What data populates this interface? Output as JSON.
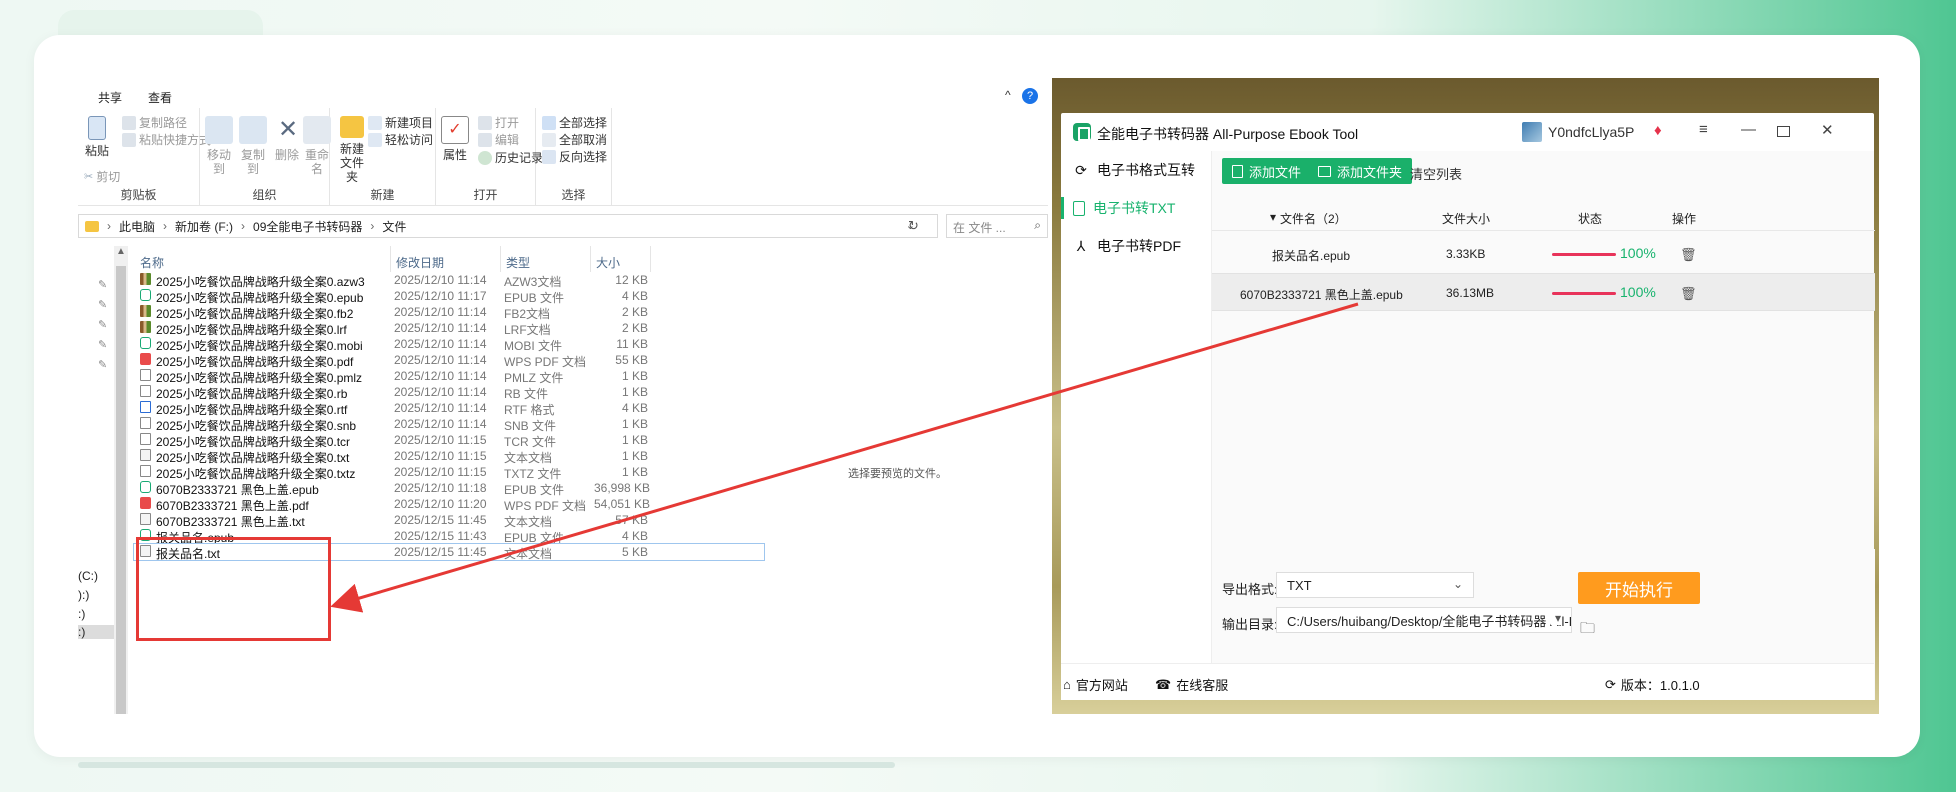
{
  "explorer": {
    "ribbon_tabs": [
      "共享",
      "查看"
    ],
    "ribbon_ctrl_chevron": "^",
    "ribbon_ctrl_help": "?",
    "clipboard": {
      "paste": "粘贴",
      "copy_path": "复制路径",
      "paste_shortcut": "粘贴快捷方式",
      "cut": "剪切",
      "group": "剪贴板"
    },
    "organize": {
      "move_to": "移动到",
      "copy_to": "复制到",
      "delete": "删除",
      "rename": "重命名",
      "group": "组织"
    },
    "new": {
      "new_folder_line1": "新建",
      "new_folder_line2": "文件夹",
      "new_item": "新建项目",
      "easy_access": "轻松访问",
      "group": "新建"
    },
    "open": {
      "properties": "属性",
      "open": "打开",
      "edit": "编辑",
      "history": "历史记录",
      "group": "打开"
    },
    "select": {
      "select_all": "全部选择",
      "select_none": "全部取消",
      "invert": "反向选择",
      "group": "选择"
    },
    "breadcrumb": [
      "此电脑",
      "新加卷 (F:)",
      "09全能电子书转码器",
      "文件"
    ],
    "search_placeholder": "在 文件 ...",
    "nav_drives": [
      "(C:)",
      "):)",
      ":)",
      ":)"
    ],
    "columns": {
      "name": "名称",
      "date": "修改日期",
      "type": "类型",
      "size": "大小"
    },
    "files": [
      {
        "name": "2025小吃餐饮品牌战略升级全案0.azw3",
        "date": "2025/12/10 11:14",
        "type": "AZW3文档",
        "size": "12 KB",
        "icon": "azw-icon"
      },
      {
        "name": "2025小吃餐饮品牌战略升级全案0.epub",
        "date": "2025/12/10 11:17",
        "type": "EPUB 文件",
        "size": "4 KB",
        "icon": "epub-icon"
      },
      {
        "name": "2025小吃餐饮品牌战略升级全案0.fb2",
        "date": "2025/12/10 11:14",
        "type": "FB2文档",
        "size": "2 KB",
        "icon": "azw-icon"
      },
      {
        "name": "2025小吃餐饮品牌战略升级全案0.lrf",
        "date": "2025/12/10 11:14",
        "type": "LRF文档",
        "size": "2 KB",
        "icon": "azw-icon"
      },
      {
        "name": "2025小吃餐饮品牌战略升级全案0.mobi",
        "date": "2025/12/10 11:14",
        "type": "MOBI 文件",
        "size": "11 KB",
        "icon": "epub-icon"
      },
      {
        "name": "2025小吃餐饮品牌战略升级全案0.pdf",
        "date": "2025/12/10 11:14",
        "type": "WPS PDF 文档",
        "size": "55 KB",
        "icon": "pdf-icon"
      },
      {
        "name": "2025小吃餐饮品牌战略升级全案0.pmlz",
        "date": "2025/12/10 11:14",
        "type": "PMLZ 文件",
        "size": "1 KB",
        "icon": "doc-icon"
      },
      {
        "name": "2025小吃餐饮品牌战略升级全案0.rb",
        "date": "2025/12/10 11:14",
        "type": "RB 文件",
        "size": "1 KB",
        "icon": "doc-icon"
      },
      {
        "name": "2025小吃餐饮品牌战略升级全案0.rtf",
        "date": "2025/12/10 11:14",
        "type": "RTF 格式",
        "size": "4 KB",
        "icon": "rtf-icon"
      },
      {
        "name": "2025小吃餐饮品牌战略升级全案0.snb",
        "date": "2025/12/10 11:14",
        "type": "SNB 文件",
        "size": "1 KB",
        "icon": "doc-icon"
      },
      {
        "name": "2025小吃餐饮品牌战略升级全案0.tcr",
        "date": "2025/12/10 11:15",
        "type": "TCR 文件",
        "size": "1 KB",
        "icon": "doc-icon"
      },
      {
        "name": "2025小吃餐饮品牌战略升级全案0.txt",
        "date": "2025/12/10 11:15",
        "type": "文本文档",
        "size": "1 KB",
        "icon": "txt-icon"
      },
      {
        "name": "2025小吃餐饮品牌战略升级全案0.txtz",
        "date": "2025/12/10 11:15",
        "type": "TXTZ 文件",
        "size": "1 KB",
        "icon": "doc-icon"
      },
      {
        "name": "6070B2333721 黑色上盖.epub",
        "date": "2025/12/10 11:18",
        "type": "EPUB 文件",
        "size": "36,998 KB",
        "icon": "epub-icon"
      },
      {
        "name": "6070B2333721 黑色上盖.pdf",
        "date": "2025/12/10 11:20",
        "type": "WPS PDF 文档",
        "size": "54,051 KB",
        "icon": "pdf-icon"
      },
      {
        "name": "6070B2333721 黑色上盖.txt",
        "date": "2025/12/15 11:45",
        "type": "文本文档",
        "size": "57 KB",
        "icon": "txt-icon"
      },
      {
        "name": "报关品名.epub",
        "date": "2025/12/15 11:43",
        "type": "EPUB 文件",
        "size": "4 KB",
        "icon": "epub-icon"
      },
      {
        "name": "报关品名.txt",
        "date": "2025/12/15 11:45",
        "type": "文本文档",
        "size": "5 KB",
        "icon": "txt-icon"
      }
    ],
    "preview_message": "选择要预览的文件。"
  },
  "app": {
    "title": "全能电子书转码器 All-Purpose Ebook Tool",
    "username": "Y0ndfcLlya5P",
    "sidebar": [
      {
        "label": "电子书格式互转",
        "icon": "refresh-icon",
        "active": false
      },
      {
        "label": "电子书转TXT",
        "icon": "txt-doc-icon",
        "active": true
      },
      {
        "label": "电子书转PDF",
        "icon": "pdf-icon",
        "active": false
      }
    ],
    "toolbar": {
      "add_file": "添加文件",
      "add_folder": "添加文件夹",
      "clear_list": "清空列表"
    },
    "table": {
      "col_name": "文件名（2）",
      "col_size": "文件大小",
      "col_status": "状态",
      "col_action": "操作",
      "rows": [
        {
          "name": "报关品名.epub",
          "size": "3.33KB",
          "progress": 1.0,
          "progress_label": "100%"
        },
        {
          "name": "6070B2333721 黑色上盖.epub",
          "size": "36.13MB",
          "progress": 1.0,
          "progress_label": "100%"
        }
      ]
    },
    "output_format_label": "导出格式:",
    "output_format_value": "TXT",
    "output_dir_label": "输出目录:",
    "output_dir_value": "C:/Users/huibang/Desktop/全能电子书转码器 All-Pu",
    "start_button": "开始执行",
    "footer": {
      "website": "官方网站",
      "support": "在线客服",
      "version": "版本：1.0.1.0"
    }
  },
  "colors": {
    "accent_green": "#1ab06a",
    "start_orange": "#ff9b1e",
    "progress_red": "#e8335a",
    "highlight_red": "#e53935"
  }
}
